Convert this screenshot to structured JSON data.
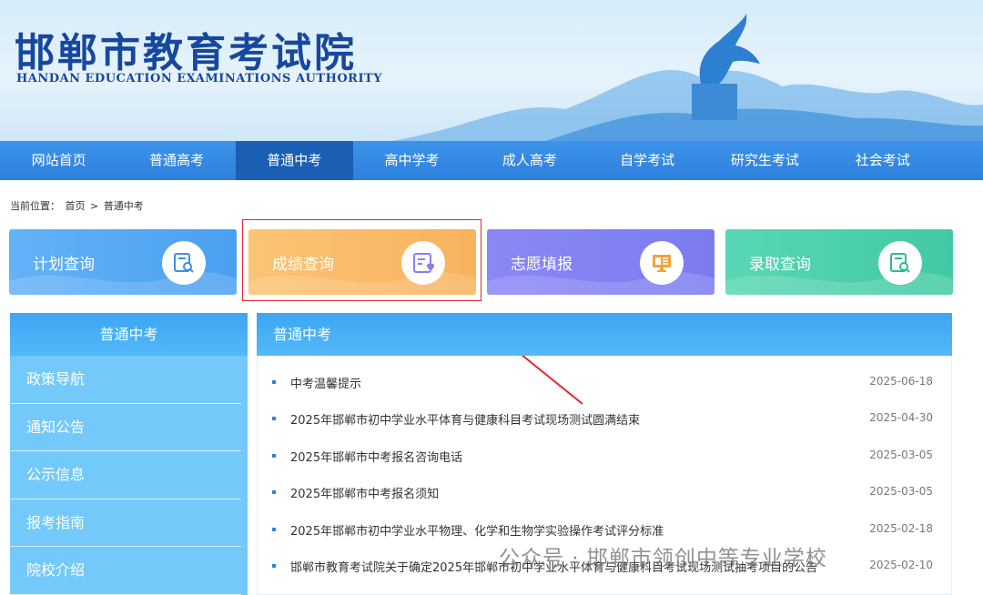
{
  "header": {
    "title": "邯郸市教育考试院",
    "subtitle": "HANDAN EDUCATION EXAMINATIONS AUTHORITY"
  },
  "nav": {
    "items": [
      "网站首页",
      "普通高考",
      "普通中考",
      "高中学考",
      "成人高考",
      "自学考试",
      "研究生考试",
      "社会考试"
    ],
    "active": "普通中考"
  },
  "breadcrumb": {
    "prefix": "当前位置：",
    "home": "首页",
    "separator": ">",
    "current": "普通中考"
  },
  "cards": [
    {
      "label": "计划查询",
      "icon": "search-document-icon",
      "color": "#4aa0f0"
    },
    {
      "label": "成绩查询",
      "icon": "score-card-icon",
      "color": "#f8b25c"
    },
    {
      "label": "志愿填报",
      "icon": "monitor-form-icon",
      "color": "#7b7bf0"
    },
    {
      "label": "录取查询",
      "icon": "search-document-icon",
      "color": "#41c9a3"
    }
  ],
  "sidebar": {
    "title": "普通中考",
    "items": [
      "政策导航",
      "通知公告",
      "公示信息",
      "报考指南",
      "院校介绍"
    ]
  },
  "main": {
    "title": "普通中考",
    "rows": [
      {
        "title": "中考温馨提示",
        "date": "2025-06-18"
      },
      {
        "title": "2025年邯郸市初中学业水平体育与健康科目考试现场测试圆满结束",
        "date": "2025-04-30"
      },
      {
        "title": "2025年邯郸市中考报名咨询电话",
        "date": "2025-03-05"
      },
      {
        "title": "2025年邯郸市中考报名须知",
        "date": "2025-03-05"
      },
      {
        "title": "2025年邯郸市初中学业水平物理、化学和生物学实验操作考试评分标准",
        "date": "2025-02-18"
      },
      {
        "title": "邯郸市教育考试院关于确定2025年邯郸市初中学业水平体育与健康科目考试现场测试抽考项目的公告",
        "date": "2025-02-10"
      }
    ]
  },
  "watermark": "公众号 · 邯郸市领创中等专业学校",
  "colors": {
    "brand": "#17479e",
    "nav": "#2d80dc",
    "highlight": "#e0262b"
  }
}
